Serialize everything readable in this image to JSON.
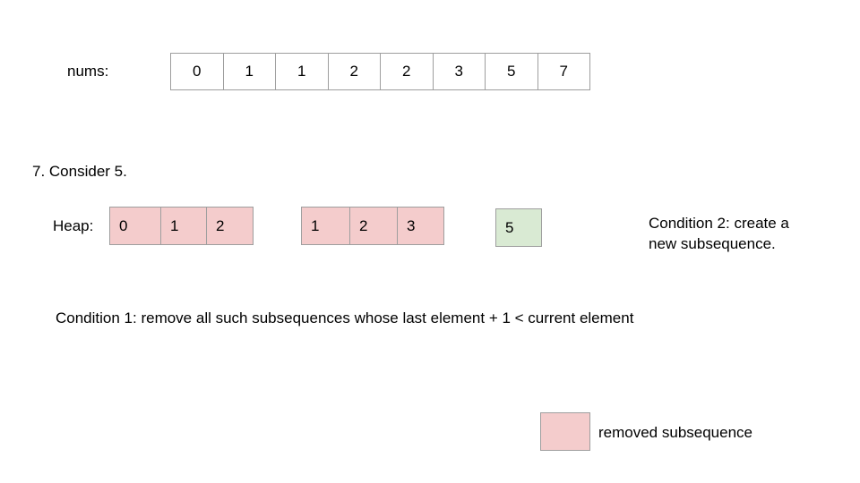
{
  "nums": {
    "label": "nums:",
    "values": [
      "0",
      "1",
      "1",
      "2",
      "2",
      "3",
      "5",
      "7"
    ]
  },
  "step": {
    "title": "7. Consider 5."
  },
  "heap": {
    "label": "Heap:",
    "subsequences": [
      {
        "values": [
          "0",
          "1",
          "2"
        ],
        "status": "removed"
      },
      {
        "values": [
          "1",
          "2",
          "3"
        ],
        "status": "removed"
      },
      {
        "values": [
          "5"
        ],
        "status": "new"
      }
    ]
  },
  "conditions": {
    "condition2_line1": "Condition 2: create a",
    "condition2_line2": "new subsequence.",
    "condition1": "Condition 1: remove all such subsequences whose last element + 1 < current element"
  },
  "legend": {
    "label": "removed subsequence"
  },
  "colors": {
    "removed": "#f4cccc",
    "new": "#d9ead3",
    "border": "#9e9e9e"
  }
}
